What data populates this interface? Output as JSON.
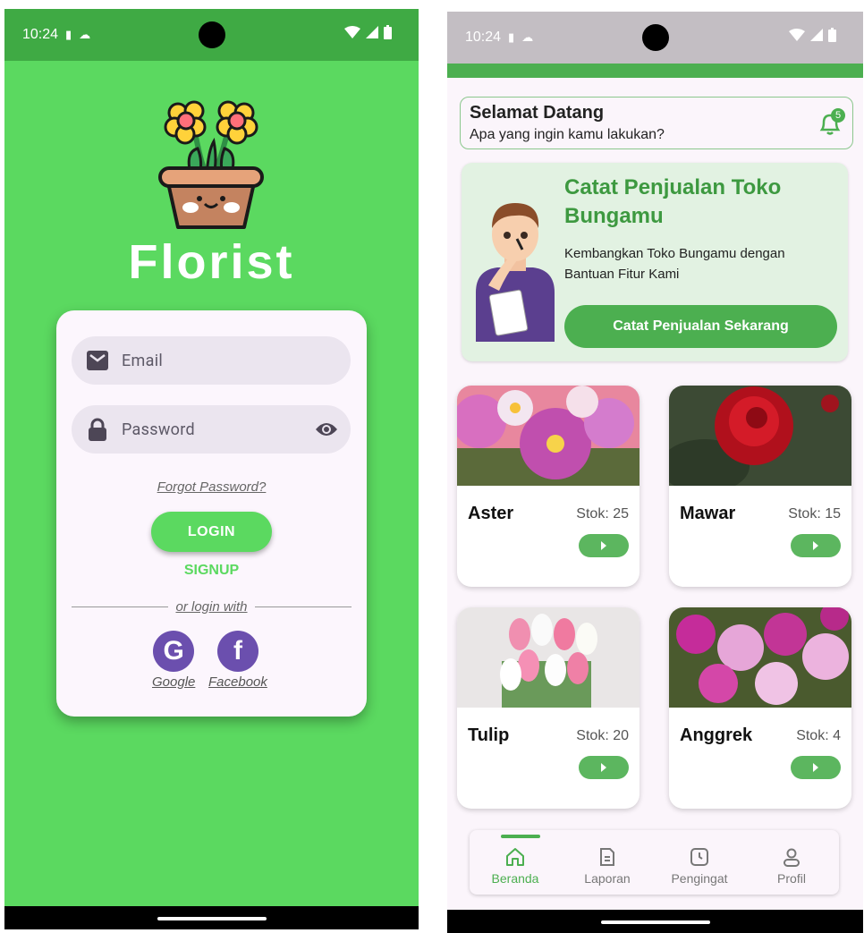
{
  "login_screen": {
    "status": {
      "time": "10:24"
    },
    "brand": "Florist",
    "email_placeholder": "Email",
    "password_placeholder": "Password",
    "forgot_password": "Forgot Password?",
    "login_button": "LOGIN",
    "signup_button": "SIGNUP",
    "divider_text": "or login with",
    "google_label": "Google",
    "facebook_label": "Facebook",
    "icons": [
      "mail-icon",
      "lock-icon",
      "eye-icon",
      "google-icon",
      "facebook-icon"
    ],
    "colors": {
      "primary": "#5bd960",
      "accent_purple": "#6b4fae"
    }
  },
  "home_screen": {
    "status": {
      "time": "10:24"
    },
    "welcome": {
      "title": "Selamat Datang",
      "subtitle": "Apa yang ingin kamu lakukan?",
      "notification_count": "5"
    },
    "promo": {
      "title": "Catat Penjualan Toko Bungamu",
      "description": "Kembangkan Toko Bungamu dengan Bantuan Fitur Kami",
      "button": "Catat Penjualan Sekarang"
    },
    "products": [
      {
        "name": "Aster",
        "stock": "Stok: 25"
      },
      {
        "name": "Mawar",
        "stock": "Stok: 15"
      },
      {
        "name": "Tulip",
        "stock": "Stok: 20"
      },
      {
        "name": "Anggrek",
        "stock": "Stok: 4"
      }
    ],
    "nav": [
      {
        "label": "Beranda",
        "active": true
      },
      {
        "label": "Laporan"
      },
      {
        "label": "Pengingat"
      },
      {
        "label": "Profil"
      }
    ],
    "colors": {
      "primary": "#4caf50",
      "promo_bg": "#e2f2e2"
    }
  }
}
